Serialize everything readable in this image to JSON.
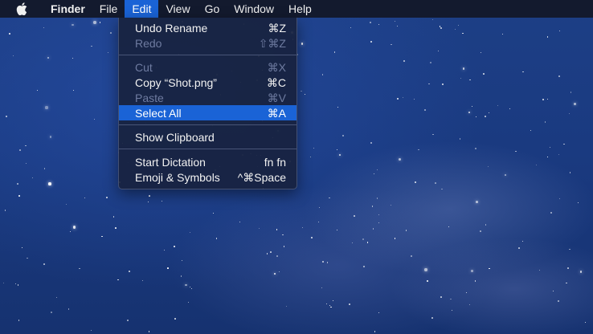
{
  "menubar": {
    "apple_icon": "apple-logo-icon",
    "items": [
      {
        "label": "Finder"
      },
      {
        "label": "File"
      },
      {
        "label": "Edit"
      },
      {
        "label": "Go"
      },
      {
        "label": "Window"
      },
      {
        "label": "Help"
      }
    ],
    "view_label": "View"
  },
  "edit_menu": {
    "undo": {
      "label": "Undo Rename",
      "shortcut": "⌘Z"
    },
    "redo": {
      "label": "Redo",
      "shortcut": "⇧⌘Z"
    },
    "cut": {
      "label": "Cut",
      "shortcut": "⌘X"
    },
    "copy": {
      "label": "Copy “Shot.png”",
      "shortcut": "⌘C"
    },
    "paste": {
      "label": "Paste",
      "shortcut": "⌘V"
    },
    "select_all": {
      "label": "Select All",
      "shortcut": "⌘A"
    },
    "show_clipboard": {
      "label": "Show Clipboard"
    },
    "dictation": {
      "label": "Start Dictation",
      "shortcut": "fn fn"
    },
    "emoji": {
      "label": "Emoji & Symbols",
      "shortcut": "^⌘Space"
    }
  },
  "colors": {
    "highlight": "#1a63d6",
    "menubar": "#131a2e",
    "desktop": "#1d3f86"
  }
}
